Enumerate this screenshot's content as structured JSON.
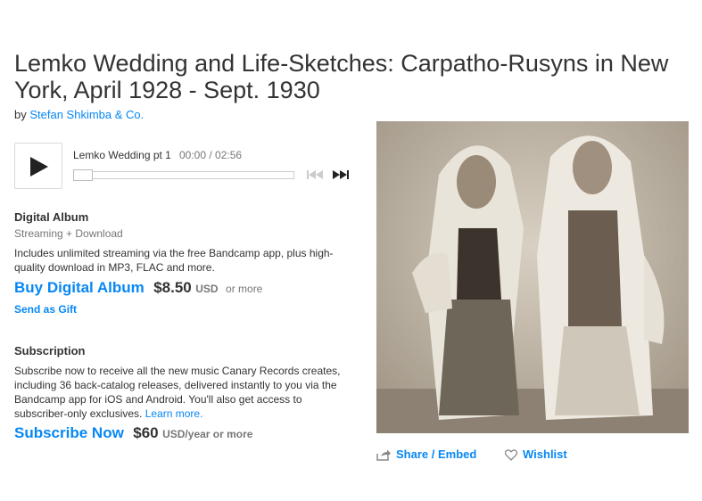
{
  "album": {
    "title": "Lemko Wedding and Life-Sketches: Carpatho-Rusyns in New York, April 1928 - Sept. 1930",
    "by_prefix": "by",
    "artist": "Stefan Shkimba & Co."
  },
  "player": {
    "track_title": "Lemko Wedding pt 1",
    "time": "00:00 / 02:56",
    "progress": 0.0
  },
  "digital": {
    "heading": "Digital Album",
    "format": "Streaming + Download",
    "description": "Includes unlimited streaming via the free Bandcamp app, plus high-quality download in MP3, FLAC and more.",
    "buy_label": "Buy Digital Album",
    "price": "$8.50",
    "currency": "USD",
    "or_more": "or more",
    "gift_label": "Send as Gift"
  },
  "subscription": {
    "heading": "Subscription",
    "description": "Subscribe now to receive all the new music Canary Records creates, including 36 back-catalog releases, delivered instantly to you via the Bandcamp app for iOS and Android. You'll also get access to subscriber-only exclusives.",
    "learn_more": "Learn more.",
    "subscribe_label": "Subscribe Now",
    "price": "$60",
    "period": "USD/year or more"
  },
  "actions": {
    "share_label": "Share / Embed",
    "wishlist_label": "Wishlist"
  },
  "colors": {
    "link": "#0687f5",
    "text": "#333333",
    "muted": "#777777"
  },
  "icons": [
    "play-icon",
    "prev-track-icon",
    "next-track-icon",
    "share-icon",
    "heart-icon"
  ]
}
